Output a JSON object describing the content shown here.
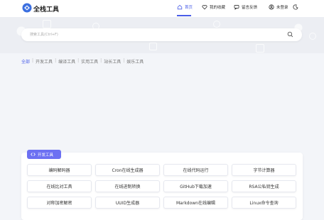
{
  "header": {
    "brand": "全栈工具",
    "nav": [
      {
        "label": "首页",
        "icon": "home-icon",
        "active": true
      },
      {
        "label": "我的收藏",
        "icon": "heart-icon",
        "active": false
      },
      {
        "label": "留言反馈",
        "icon": "chat-icon",
        "active": false
      },
      {
        "label": "未登录",
        "icon": "user-icon",
        "active": false
      }
    ],
    "theme_icon": "moon-icon"
  },
  "search": {
    "placeholder": "搜索工具(Ctrl+F)"
  },
  "categories": [
    "全部",
    "开发工具",
    "编译工具",
    "实用工具",
    "站长工具",
    "娱乐工具"
  ],
  "active_category": "全部",
  "section": {
    "tag": "开发工具",
    "tag_icon": "code-brackets-icon",
    "tools": [
      "编码解码器",
      "Cron在线生成器",
      "在线代码运行",
      "字节计算器",
      "在线比对工具",
      "在线进制转换",
      "GitHub下载加速",
      "RSA公私钥生成",
      "对称加密解密",
      "UUID生成器",
      "Markdown在线编辑",
      "Linux命令查询"
    ]
  },
  "colors": {
    "accent": "#4a5ee8",
    "tag_bg": "#6c70f2",
    "page_bg": "#f3f5f9"
  }
}
